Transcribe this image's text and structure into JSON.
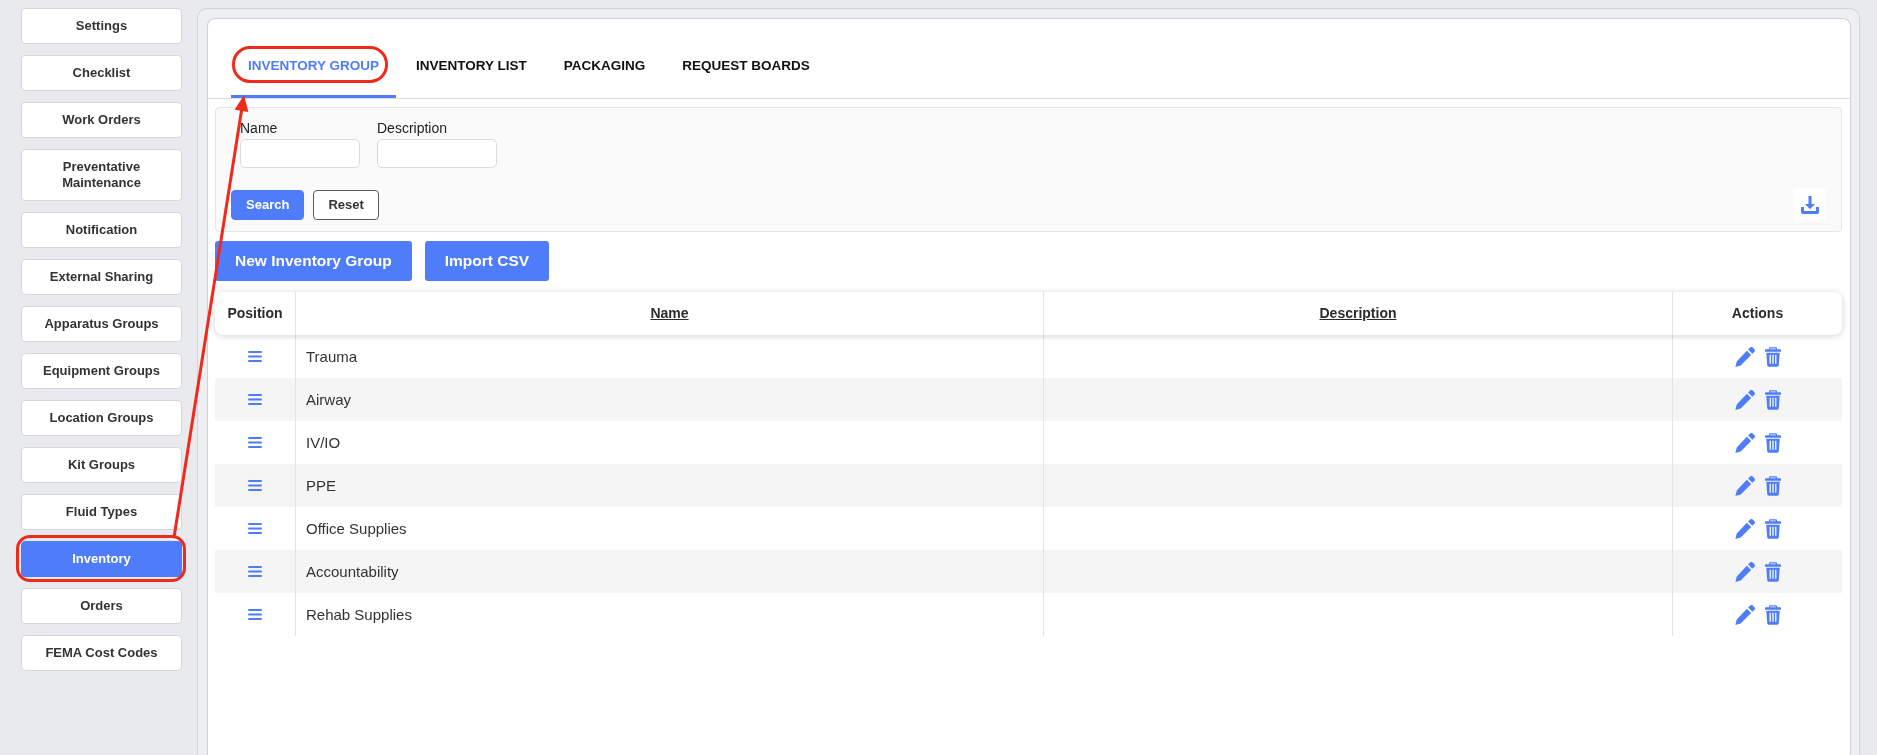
{
  "sidebar": {
    "items": [
      {
        "label": "Settings",
        "selected": false,
        "highlighted": false
      },
      {
        "label": "Checklist",
        "selected": false,
        "highlighted": false
      },
      {
        "label": "Work Orders",
        "selected": false,
        "highlighted": false
      },
      {
        "label": "Preventative Maintenance",
        "selected": false,
        "highlighted": false
      },
      {
        "label": "Notification",
        "selected": false,
        "highlighted": false
      },
      {
        "label": "External Sharing",
        "selected": false,
        "highlighted": false
      },
      {
        "label": "Apparatus Groups",
        "selected": false,
        "highlighted": false
      },
      {
        "label": "Equipment Groups",
        "selected": false,
        "highlighted": false
      },
      {
        "label": "Location Groups",
        "selected": false,
        "highlighted": false
      },
      {
        "label": "Kit Groups",
        "selected": false,
        "highlighted": false
      },
      {
        "label": "Fluid Types",
        "selected": false,
        "highlighted": false
      },
      {
        "label": "Inventory",
        "selected": true,
        "highlighted": true
      },
      {
        "label": "Orders",
        "selected": false,
        "highlighted": false
      },
      {
        "label": "FEMA Cost Codes",
        "selected": false,
        "highlighted": false
      }
    ]
  },
  "tabs": [
    {
      "label": "INVENTORY GROUP",
      "selected": true,
      "highlighted": true
    },
    {
      "label": "INVENTORY LIST",
      "selected": false,
      "highlighted": false
    },
    {
      "label": "PACKAGING",
      "selected": false,
      "highlighted": false
    },
    {
      "label": "REQUEST BOARDS",
      "selected": false,
      "highlighted": false
    }
  ],
  "filters": {
    "fields": [
      {
        "label": "Name"
      },
      {
        "label": "Description"
      }
    ],
    "buttons": [
      {
        "label": "Search",
        "kind": "primary"
      },
      {
        "label": "Reset",
        "kind": "secondary"
      }
    ]
  },
  "actions": [
    {
      "label": "New Inventory Group"
    },
    {
      "label": "Import CSV"
    }
  ],
  "table": {
    "columns": [
      {
        "label": "Position",
        "sortable": false
      },
      {
        "label": "Name",
        "sortable": true
      },
      {
        "label": "Description",
        "sortable": true
      },
      {
        "label": "Actions",
        "sortable": false
      }
    ],
    "rows": [
      {
        "name": "Trauma"
      },
      {
        "name": "Airway"
      },
      {
        "name": "IV/IO"
      },
      {
        "name": "PPE"
      },
      {
        "name": "Office Supplies"
      },
      {
        "name": "Accountability"
      },
      {
        "name": "Rehab Supplies"
      }
    ]
  }
}
